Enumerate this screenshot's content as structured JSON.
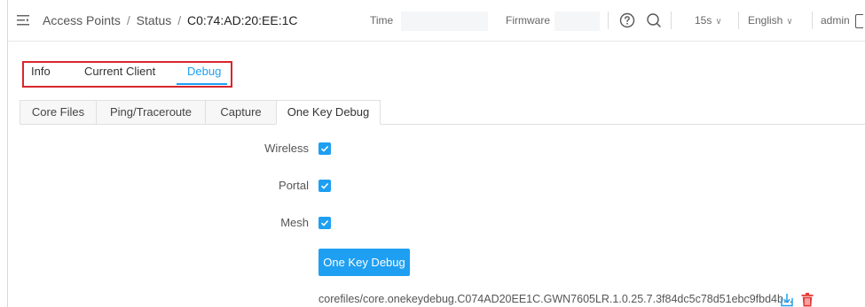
{
  "header": {
    "breadcrumb": {
      "section": "Access Points",
      "separator1": "/",
      "subsection": "Status",
      "separator2": "/",
      "current": "C0:74:AD:20:EE:1C"
    },
    "time_label": "Time",
    "time_value": "",
    "firmware_label": "Firmware",
    "firmware_value": "",
    "refresh_interval": "15s",
    "language": "English",
    "user": "admin"
  },
  "main_tabs": [
    {
      "label": "Info",
      "active": false
    },
    {
      "label": "Current Client",
      "active": false
    },
    {
      "label": "Debug",
      "active": true
    }
  ],
  "sub_tabs": [
    {
      "label": "Core Files",
      "active": false
    },
    {
      "label": "Ping/Traceroute",
      "active": false
    },
    {
      "label": "Capture",
      "active": false
    },
    {
      "label": "One Key Debug",
      "active": true
    }
  ],
  "form": {
    "wireless_label": "Wireless",
    "wireless_checked": true,
    "portal_label": "Portal",
    "portal_checked": true,
    "mesh_label": "Mesh",
    "mesh_checked": true,
    "button_label": "One Key Debug",
    "file_name": "corefiles/core.onekeydebug.C074AD20EE1C.GWN7605LR.1.0.25.7.3f84dc5c78d51ebc9fbd4b..."
  },
  "icons": {
    "menu": "menu-collapse-icon",
    "help": "help-circle-icon",
    "search": "search-icon",
    "chevron": "chevron-down-icon",
    "download": "download-icon",
    "delete": "trash-icon",
    "logout": "logout-icon"
  },
  "colors": {
    "accent": "#1e9ff2",
    "highlight_box": "#d9262c",
    "delete": "#e53935"
  }
}
